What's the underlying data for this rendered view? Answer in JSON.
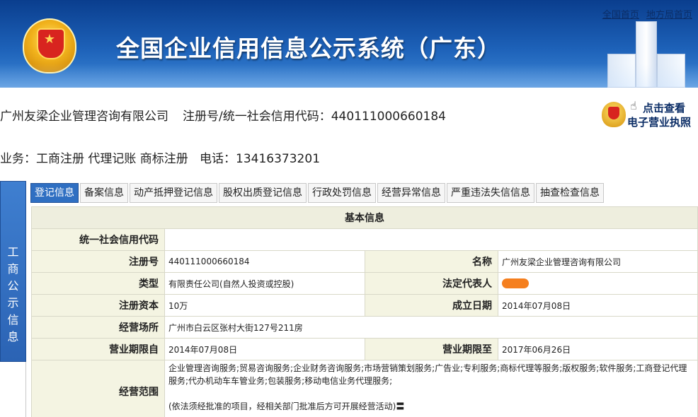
{
  "header": {
    "title": "全国企业信用信息公示系统（广东）",
    "links": [
      "全国首页",
      "地方局首页"
    ]
  },
  "company": {
    "name": "广州友梁企业管理咨询有限公司",
    "reg_label": "注册号/统一社会信用代码：",
    "reg_no": "440111000660184",
    "business": "业务：工商注册 代理记账 商标注册",
    "phone_label": "电话：",
    "phone": "13416373201"
  },
  "license_button": {
    "line1": "点击查看",
    "line2": "电子营业执照"
  },
  "side_tab": {
    "chars": [
      "工",
      "商",
      "公",
      "示",
      "信",
      "息"
    ]
  },
  "tabs": [
    "登记信息",
    "备案信息",
    "动产抵押登记信息",
    "股权出质登记信息",
    "行政处罚信息",
    "经营异常信息",
    "严重违法失信信息",
    "抽查检查信息"
  ],
  "basic_info": {
    "heading": "基本信息",
    "credit_code_label": "统一社会信用代码",
    "credit_code_value": "",
    "reg_no_label": "注册号",
    "reg_no_value": "440111000660184",
    "name_label": "名称",
    "name_value": "广州友梁企业管理咨询有限公司",
    "type_label": "类型",
    "type_value": "有限责任公司(自然人投资或控股)",
    "legal_rep_label": "法定代表人",
    "capital_label": "注册资本",
    "capital_value": "10万",
    "established_label": "成立日期",
    "established_value": "2014年07月08日",
    "address_label": "经营场所",
    "address_value": "广州市白云区张村大街127号211房",
    "term_from_label": "营业期限自",
    "term_from_value": "2014年07月08日",
    "term_to_label": "营业期限至",
    "term_to_value": "2017年06月26日",
    "scope_label": "经营范围",
    "scope_value": "企业管理咨询服务;贸易咨询服务;企业财务咨询服务;市场营销策划服务;广告业;专利服务;商标代理等服务;版权服务;软件服务;工商登记代理服务;代办机动车车管业务;包装服务;移动电信业务代理服务;",
    "scope_note": "(依法须经批准的项目，经相关部门批准后方可开展经营活动)〓"
  },
  "colors": {
    "banner": "#1d61b8",
    "tab_active": "#2f6fc2",
    "label_bg": "#f4f4e2",
    "redaction": "#f57f1e"
  }
}
